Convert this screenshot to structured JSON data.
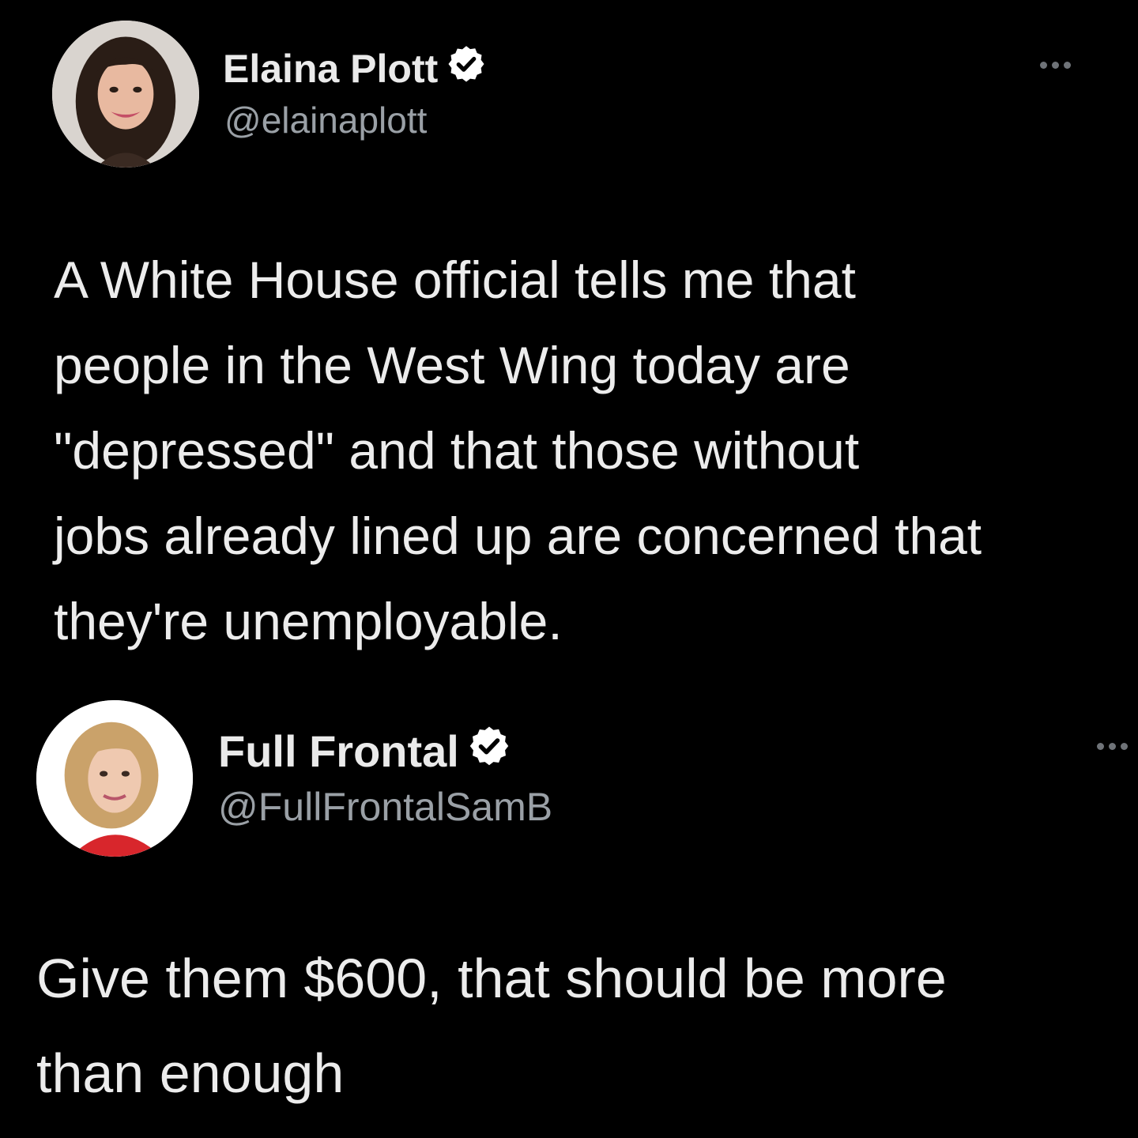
{
  "colors": {
    "background": "#000000",
    "text": "#ececec",
    "handle": "#9aa0a6",
    "verified_badge": "#ffffff",
    "more_dots": "#6f7378"
  },
  "tweets": [
    {
      "display_name": "Elaina Plott",
      "handle": "@elainaplott",
      "verified": true,
      "avatar_icon": "user-avatar-photo",
      "more_icon": "ellipsis-icon",
      "text": "A White House official tells me that\npeople in the West Wing today are\n\"depressed\" and that those without\njobs already lined up are concerned that\nthey're unemployable."
    },
    {
      "display_name": "Full Frontal",
      "handle": "@FullFrontalSamB",
      "verified": true,
      "avatar_icon": "user-avatar-photo",
      "more_icon": "ellipsis-icon",
      "text": "Give them $600, that should be more\nthan enough"
    }
  ]
}
